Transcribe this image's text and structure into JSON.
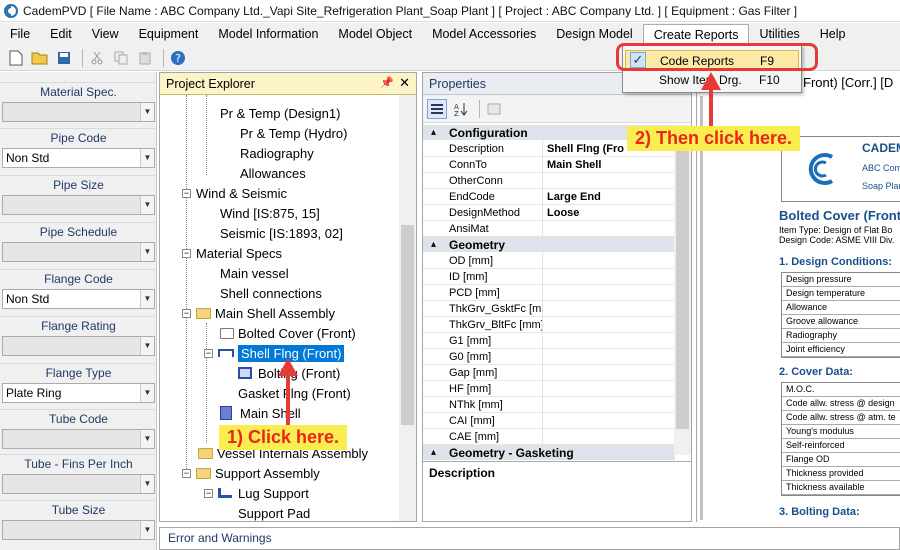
{
  "window": {
    "title": "CademPVD [ File Name : ABC Company Ltd._Vapi Site_Refrigeration Plant_Soap Plant ] [ Project : ABC Company Ltd. ] [ Equipment : Gas Filter ]"
  },
  "menu": [
    "File",
    "Edit",
    "View",
    "Equipment",
    "Model Information",
    "Model Object",
    "Model Accessories",
    "Design Model",
    "Create Reports",
    "Utilities",
    "Help"
  ],
  "toolbar_icons": [
    "new-icon",
    "open-icon",
    "save-icon",
    "cut-icon",
    "copy-icon",
    "paste-icon",
    "help-icon"
  ],
  "left_panel": [
    {
      "label": "Material Spec.",
      "value": ""
    },
    {
      "label": "Pipe Code",
      "value": "Non Std"
    },
    {
      "label": "Pipe Size",
      "value": ""
    },
    {
      "label": "Pipe Schedule",
      "value": ""
    },
    {
      "label": "Flange Code",
      "value": "Non Std"
    },
    {
      "label": "Flange Rating",
      "value": ""
    },
    {
      "label": "Flange Type",
      "value": "Plate Ring"
    },
    {
      "label": "Tube Code",
      "value": ""
    },
    {
      "label": "Tube - Fins Per Inch",
      "value": ""
    },
    {
      "label": "Tube Size",
      "value": ""
    }
  ],
  "explorer": {
    "title": "Project Explorer",
    "items": [
      "Pr & Temp (Design1)",
      "Pr & Temp (Hydro)",
      "Radiography",
      "Allowances",
      "Wind & Seismic",
      "Wind [IS:875, 15]",
      "Seismic [IS:1893, 02]",
      "Material Specs",
      "Main vessel",
      "Shell connections",
      "Main Shell Assembly",
      "Bolted Cover (Front)",
      "Shell Flng (Front)",
      "Bolting (Front)",
      "Gasket Flng (Front)",
      "Main Shell",
      "Vessel Internals Assembly",
      "Support Assembly",
      "Lug Support",
      "Support Pad"
    ]
  },
  "properties": {
    "title": "Properties",
    "categories": {
      "configuration": "Configuration",
      "geometry": "Geometry",
      "geometry_gasketing": "Geometry - Gasketing"
    },
    "config_rows": [
      {
        "k": "Description",
        "v": "Shell Flng (Fro"
      },
      {
        "k": "ConnTo",
        "v": "Main Shell"
      },
      {
        "k": "OtherConn",
        "v": ""
      },
      {
        "k": "EndCode",
        "v": "Large End"
      },
      {
        "k": "DesignMethod",
        "v": "Loose"
      },
      {
        "k": "AnsiMat",
        "v": ""
      }
    ],
    "geometry_rows": [
      "OD [mm]",
      "ID [mm]",
      "PCD [mm]",
      "ThkGrv_GsktFc [mr",
      "ThkGrv_BltFc [mm]",
      "G1 [mm]",
      "G0 [mm]",
      "Gap [mm]",
      "HF [mm]",
      "NThk [mm]",
      "CAI [mm]",
      "CAE [mm]"
    ],
    "description_label": "Description"
  },
  "dropdown": {
    "items": [
      {
        "label": "Code Reports",
        "shortcut": "F9"
      },
      {
        "label": "Show Item Drg.",
        "shortcut": "F10"
      }
    ]
  },
  "report": {
    "tab_title": "Front) [Corr.] [D",
    "company_short": "CADEM",
    "company_line1": "ABC Com",
    "company_line2": "Soap Plar",
    "title": "Bolted Cover (Front) -",
    "item_type": "Item Type: Design of Flat Bo",
    "design_code": "Design Code: ASME VIII Div.",
    "section1": "1. Design Conditions:",
    "section1_rows": [
      "Design pressure",
      "Design temperature",
      "Allowance",
      "Groove allowance",
      "Radiography",
      "Joint efficiency"
    ],
    "section2": "2. Cover Data:",
    "section2_rows": [
      "M.O.C.",
      "Code allw. stress @ design",
      "Code allw. stress @ atm. te",
      "Young's modulus",
      "Self-reinforced",
      "Flange OD",
      "Thickness provided",
      "Thickness available"
    ],
    "section3": "3. Bolting Data:"
  },
  "errors_label": "Error and Warnings",
  "annotations": {
    "step1": "1) Click here.",
    "step2": "2) Then click here."
  }
}
